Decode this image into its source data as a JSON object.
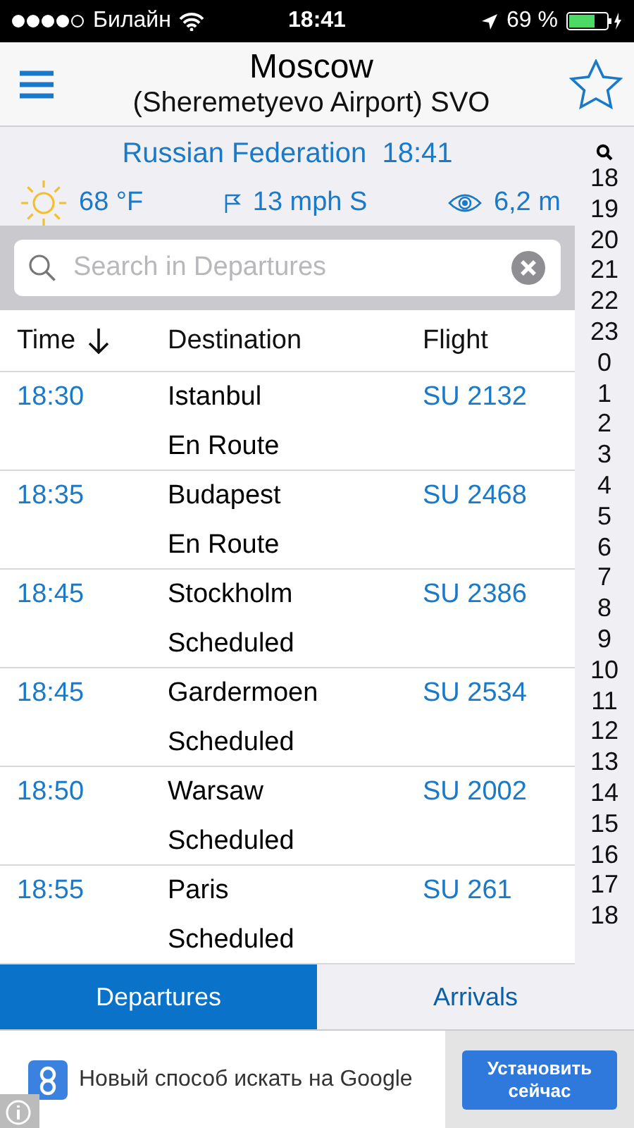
{
  "status_bar": {
    "carrier": "Билайн",
    "time": "18:41",
    "battery": "69 %"
  },
  "header": {
    "title": "Moscow",
    "subtitle": "(Sheremetyevo Airport) SVO"
  },
  "info": {
    "country": "Russian Federation",
    "local_time": "18:41",
    "temperature": "68 °F",
    "wind": "13 mph S",
    "visibility": "6,2 m"
  },
  "search": {
    "placeholder": "Search in Departures"
  },
  "table": {
    "columns": [
      "Time",
      "Destination",
      "Flight"
    ],
    "rows": [
      {
        "time": "18:30",
        "destination": "Istanbul",
        "status": "En Route",
        "flight": "SU 2132"
      },
      {
        "time": "18:35",
        "destination": "Budapest",
        "status": "En Route",
        "flight": "SU 2468"
      },
      {
        "time": "18:45",
        "destination": "Stockholm",
        "status": "Scheduled",
        "flight": "SU 2386"
      },
      {
        "time": "18:45",
        "destination": "Gardermoen",
        "status": "Scheduled",
        "flight": "SU 2534"
      },
      {
        "time": "18:50",
        "destination": "Warsaw",
        "status": "Scheduled",
        "flight": "SU 2002"
      },
      {
        "time": "18:55",
        "destination": "Paris",
        "status": "Scheduled",
        "flight": "SU 261"
      }
    ]
  },
  "hour_index": [
    "18",
    "19",
    "20",
    "21",
    "22",
    "23",
    "0",
    "1",
    "2",
    "3",
    "4",
    "5",
    "6",
    "7",
    "8",
    "9",
    "10",
    "11",
    "12",
    "13",
    "14",
    "15",
    "16",
    "17",
    "18"
  ],
  "tabs": [
    {
      "label": "Departures",
      "selected": true
    },
    {
      "label": "Arrivals",
      "selected": false
    }
  ],
  "ad": {
    "text": "Новый способ искать на Google",
    "button": "Установить сейчас"
  }
}
